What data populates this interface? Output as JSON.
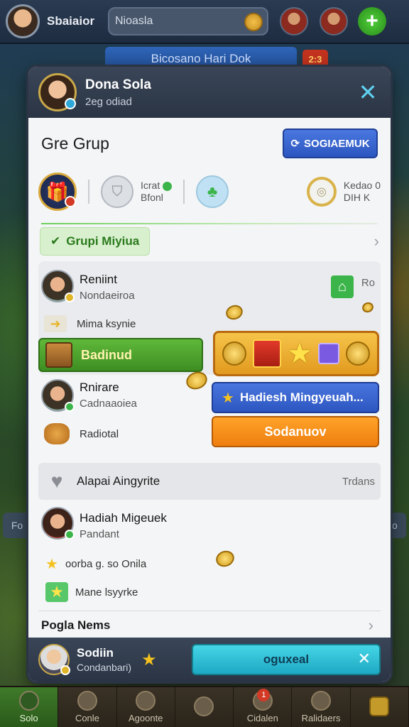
{
  "topbar": {
    "player_name": "Sbaiaior",
    "search_value": "Nioasla"
  },
  "sub_banner": {
    "label": "Bicosano Hari Dok",
    "badge": "2:3"
  },
  "side_labels": {
    "left": "Fo",
    "right": "do"
  },
  "modal": {
    "header": {
      "title": "Dona Sola",
      "subtitle": "2eg odiad",
      "close_icon": "close-icon"
    },
    "group": {
      "title": "Gre Grup",
      "button_label": "SOGIAEMUK",
      "button_icon": "refresh-icon"
    },
    "stats": {
      "gift_icon": "gift-icon",
      "shield_text_line1": "Icrat",
      "shield_text_line2": "Bfonl",
      "coin_text_line1": "Kedao 0",
      "coin_text_line2": "DIH K"
    },
    "chip": {
      "label": "Grupi Miyiua",
      "check_icon": "check-icon"
    },
    "friend1": {
      "name": "Reniint",
      "sub": "Nondaeiroa",
      "task": "Mima ksynie",
      "green_button": "Badinud",
      "house_num": "Ro"
    },
    "friend2": {
      "name": "Rnirare",
      "sub": "Cadnaaoiea",
      "task": "Radiotal",
      "weekly_button": "Hadiesh Mingyeuah...",
      "orange_button": "Sodanuov"
    },
    "section": {
      "label": "Alapai Aingyrite",
      "right": "Trdans"
    },
    "friend3": {
      "name": "Hadiah Migeuek",
      "sub": "Pandant",
      "row1": "oorba g. so Onila",
      "row2": "Mane lsyyrke"
    },
    "footer_label": "Pogla Nems",
    "notification": {
      "name": "Sodiin",
      "sub": "Condanbari)",
      "button": "oguxeal"
    }
  },
  "bottom_nav": [
    {
      "label": "Solo",
      "active": true
    },
    {
      "label": "Conle",
      "active": false
    },
    {
      "label": "Agoonte",
      "active": false
    },
    {
      "label": "",
      "active": false
    },
    {
      "label": "Cidalen",
      "active": false,
      "badge": "1"
    },
    {
      "label": "Ralidaers",
      "active": false
    },
    {
      "label": "",
      "active": false
    }
  ]
}
